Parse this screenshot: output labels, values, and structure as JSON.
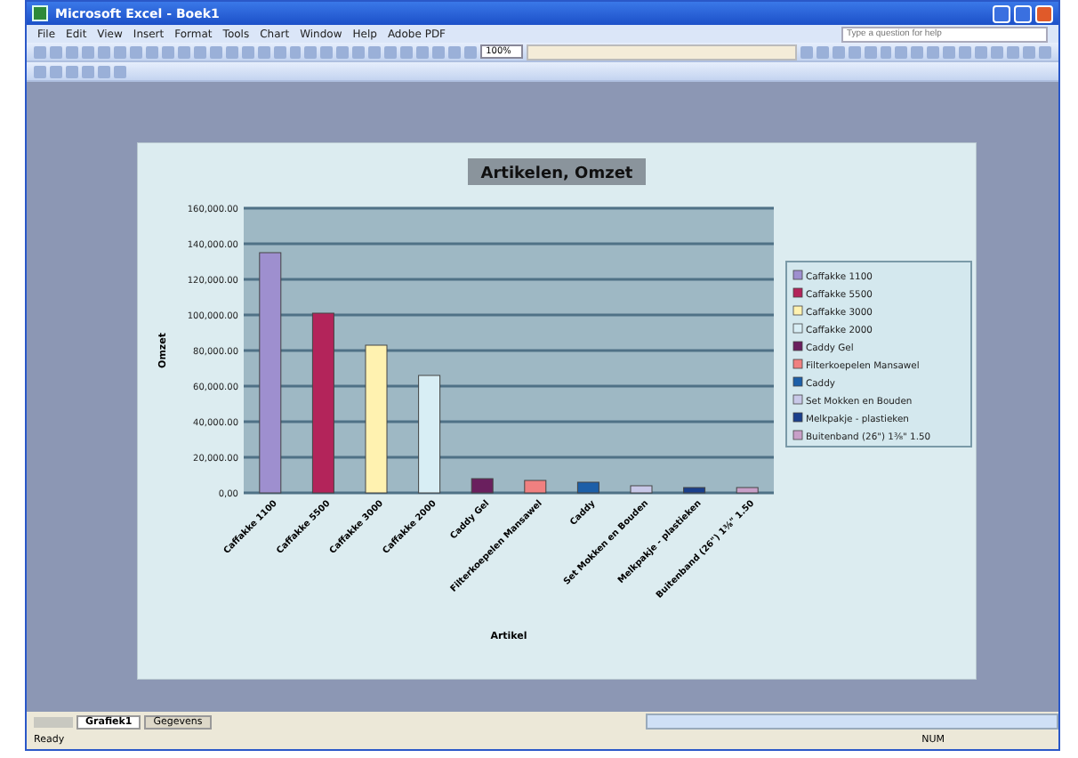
{
  "window": {
    "title": "Microsoft Excel - Boek1"
  },
  "menu": [
    "File",
    "Edit",
    "View",
    "Insert",
    "Format",
    "Tools",
    "Chart",
    "Window",
    "Help",
    "Adobe PDF"
  ],
  "help_box": {
    "placeholder": "Type a question for help"
  },
  "toolbar": {
    "zoom": "100%"
  },
  "chart": {
    "title": "Artikelen, Omzet",
    "chart_data": {
      "type": "bar",
      "xlabel": "Artikel",
      "ylabel": "Omzet",
      "categories": [
        "Caffakke 1100",
        "Caffakke 5500",
        "Caffakke 3000",
        "Caffakke 2000",
        "Caddy Gel",
        "Filterkoepelen Mansawel",
        "Caddy",
        "Set Mokken en Bouden",
        "Melkpakje - plastieken",
        "Buitenband (26\") 1⅜\" 1.50"
      ],
      "values": [
        135000,
        101000,
        83000,
        66000,
        8000,
        7000,
        6000,
        4000,
        3000,
        3000
      ],
      "colors": [
        "#9e8fcf",
        "#b3245a",
        "#fff2b0",
        "#d8eef5",
        "#6a1f5e",
        "#f08080",
        "#1d5fa8",
        "#c8c8e8",
        "#1a3f8c",
        "#c8a0c8"
      ],
      "ylim": [
        0,
        160000
      ],
      "grid": true,
      "yticks": [
        {
          "value": 0,
          "label": "0,00"
        },
        {
          "value": 20000,
          "label": "20,000.00"
        },
        {
          "value": 40000,
          "label": "40,000.00"
        },
        {
          "value": 60000,
          "label": "60,000.00"
        },
        {
          "value": 80000,
          "label": "80,000.00"
        },
        {
          "value": 100000,
          "label": "100,000.00"
        },
        {
          "value": 120000,
          "label": "120,000.00"
        },
        {
          "value": 140000,
          "label": "140,000.00"
        },
        {
          "value": 160000,
          "label": "160,000.00"
        }
      ]
    }
  },
  "sheet_tabs": [
    {
      "label": "Grafiek1",
      "selected": true
    },
    {
      "label": "Gegevens",
      "selected": false
    }
  ],
  "status_bar": {
    "left": "Ready",
    "right": "NUM"
  }
}
